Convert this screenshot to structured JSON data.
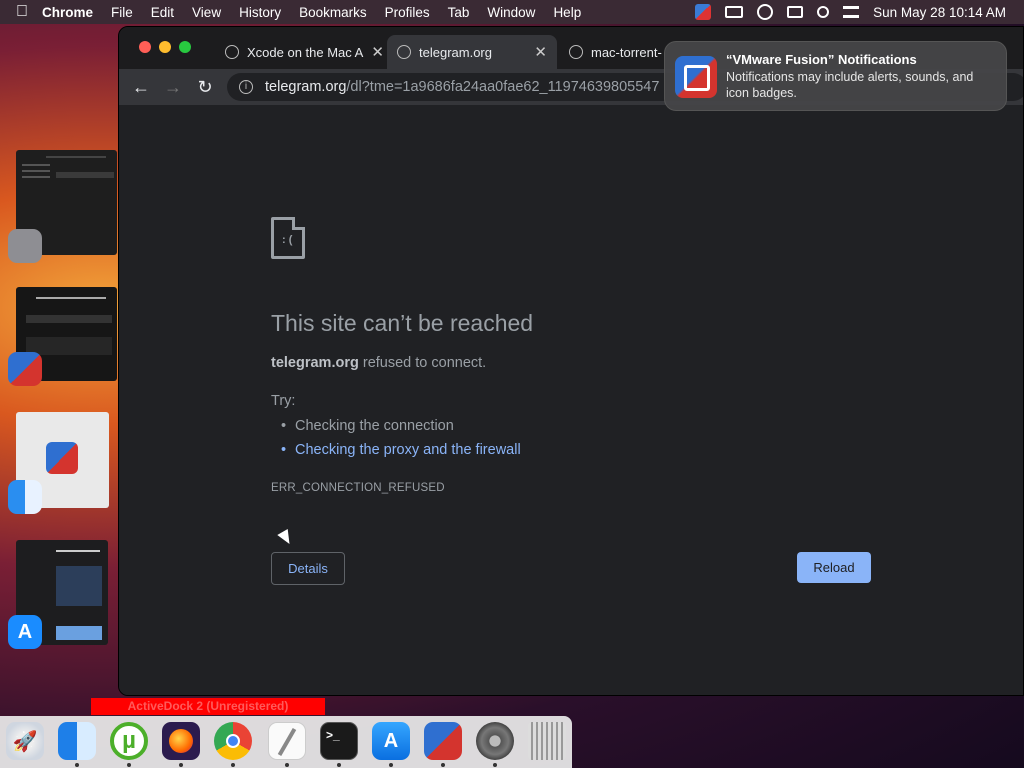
{
  "menubar": {
    "app_name": "Chrome",
    "items": [
      "File",
      "Edit",
      "View",
      "History",
      "Bookmarks",
      "Profiles",
      "Tab",
      "Window",
      "Help"
    ],
    "clock": "Sun May 28  10:14 AM",
    "status_icons": [
      "vmware-fusion-icon",
      "display-icon",
      "wordpress-icon",
      "windows-icon",
      "search-icon",
      "control-center-icon"
    ]
  },
  "browser": {
    "tabs": [
      {
        "title": "Xcode on the Mac A"
      },
      {
        "title": "telegram.org"
      },
      {
        "title": "mac-torrent-"
      }
    ],
    "url_host": "telegram.org",
    "url_path": "/dl?tme=1a9686fa24aa0fae62_11974639805547"
  },
  "error_page": {
    "title": "This site can’t be reached",
    "host": "telegram.org",
    "message": " refused to connect.",
    "try_label": "Try:",
    "suggestions": [
      "Checking the connection",
      "Checking the proxy and the firewall"
    ],
    "error_code": "ERR_CONNECTION_REFUSED",
    "details_button": "Details",
    "reload_button": "Reload"
  },
  "notification": {
    "title": "“VMware Fusion” Notifications",
    "body": "Notifications may include alerts, sounds, and icon badges."
  },
  "activedock_label": "ActiveDock 2 (Unregistered)",
  "dock": {
    "apps": [
      "launchpad-icon",
      "finder-icon",
      "utorrent-icon",
      "firefox-icon",
      "chrome-icon",
      "textedit-icon",
      "terminal-icon",
      "app-store-icon",
      "vmware-fusion-icon",
      "system-settings-icon",
      "trash-icon"
    ]
  }
}
